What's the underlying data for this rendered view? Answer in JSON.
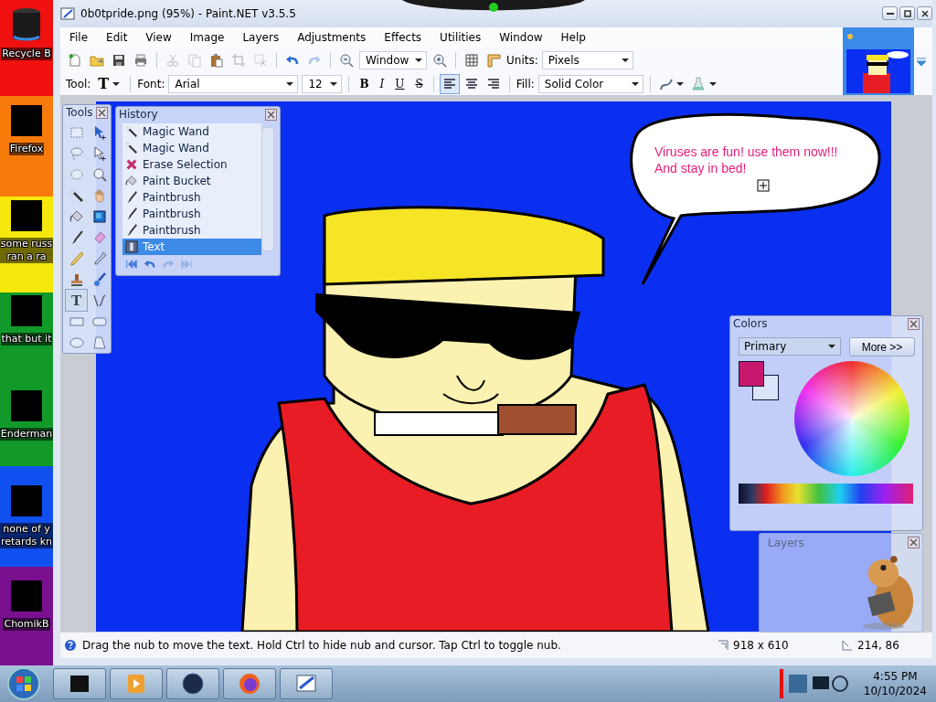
{
  "desktop_icons": [
    {
      "kind": "bin",
      "lines": [
        "Recycle B"
      ]
    },
    {
      "kind": "block",
      "lines": [
        "Firefox"
      ]
    },
    {
      "kind": "block",
      "lines": [
        "some russ",
        "ran a ra"
      ]
    },
    {
      "kind": "block",
      "lines": [
        "that but it"
      ]
    },
    {
      "kind": "block",
      "lines": [
        "Enderman"
      ]
    },
    {
      "kind": "block",
      "lines": [
        "none of y",
        "retards kn"
      ]
    },
    {
      "kind": "block",
      "lines": [
        "ChomikB"
      ]
    }
  ],
  "window": {
    "title": "0b0tpride.png (95%) - Paint.NET v3.5.5",
    "controls": [
      {
        "kind": "minimize"
      },
      {
        "kind": "maximize"
      },
      {
        "kind": "close"
      }
    ]
  },
  "menu": [
    "File",
    "Edit",
    "View",
    "Image",
    "Layers",
    "Adjustments",
    "Effects",
    "Utilities",
    "Window",
    "Help"
  ],
  "toolbar": [
    {
      "kind": "new",
      "disabled": false
    },
    {
      "kind": "open",
      "disabled": false
    },
    {
      "kind": "save",
      "disabled": false
    },
    {
      "kind": "print",
      "disabled": false
    },
    {
      "kind": "separator"
    },
    {
      "kind": "cut",
      "disabled": true
    },
    {
      "kind": "copy",
      "disabled": true
    },
    {
      "kind": "paste",
      "disabled": false
    },
    {
      "kind": "crop",
      "disabled": true
    },
    {
      "kind": "deselect",
      "disabled": true
    },
    {
      "kind": "separator"
    },
    {
      "kind": "undo",
      "disabled": false
    },
    {
      "kind": "redo",
      "disabled": true
    },
    {
      "kind": "separator"
    },
    {
      "kind": "zoom-out",
      "disabled": false
    },
    {
      "kind": "zoom-dropdown",
      "value": "Window"
    },
    {
      "kind": "zoom-in",
      "disabled": false
    },
    {
      "kind": "separator"
    },
    {
      "kind": "grid",
      "disabled": false
    },
    {
      "kind": "rulers",
      "disabled": false
    },
    {
      "kind": "label",
      "text": "Units:"
    },
    {
      "kind": "units-dropdown",
      "value": "Pixels"
    }
  ],
  "text_toolbar": [
    {
      "kind": "label",
      "text": "Tool:"
    },
    {
      "kind": "tool-picker",
      "text": "T"
    },
    {
      "kind": "separator"
    },
    {
      "kind": "label",
      "text": "Font:"
    },
    {
      "kind": "font-dropdown",
      "value": "Arial"
    },
    {
      "kind": "size-dropdown",
      "value": "12"
    },
    {
      "kind": "separator"
    },
    {
      "kind": "style",
      "text": "B",
      "selected": false
    },
    {
      "kind": "style",
      "text": "I",
      "selected": false
    },
    {
      "kind": "style",
      "text": "U",
      "selected": false
    },
    {
      "kind": "style",
      "text": "S",
      "selected": false
    },
    {
      "kind": "separator"
    },
    {
      "kind": "align-left",
      "selected": true
    },
    {
      "kind": "align-center",
      "selected": false
    },
    {
      "kind": "align-right",
      "selected": false
    },
    {
      "kind": "separator"
    },
    {
      "kind": "label",
      "text": "Fill:"
    },
    {
      "kind": "fill-dropdown",
      "value": "Solid Color"
    },
    {
      "kind": "separator"
    },
    {
      "kind": "antialias"
    },
    {
      "kind": "blend"
    }
  ],
  "canvas": {
    "bubble_text": [
      "Viruses are fun! use them now!!!",
      "And stay in bed!"
    ]
  },
  "tools_panel": {
    "title": "Tools",
    "tools": [
      {
        "kind": "rect-select",
        "selected": false
      },
      {
        "kind": "move-selected",
        "selected": false
      },
      {
        "kind": "lasso",
        "selected": false
      },
      {
        "kind": "move-selection",
        "selected": false
      },
      {
        "kind": "ellipse-select",
        "selected": false
      },
      {
        "kind": "zoom",
        "selected": false
      },
      {
        "kind": "magic-wand",
        "selected": false
      },
      {
        "kind": "pan",
        "selected": false
      },
      {
        "kind": "bucket",
        "selected": false
      },
      {
        "kind": "gradient",
        "selected": false
      },
      {
        "kind": "brush",
        "selected": false
      },
      {
        "kind": "eraser",
        "selected": false
      },
      {
        "kind": "pencil",
        "selected": false
      },
      {
        "kind": "picker",
        "selected": false
      },
      {
        "kind": "stamp",
        "selected": false
      },
      {
        "kind": "recolor",
        "selected": false
      },
      {
        "kind": "text",
        "glyph": "T",
        "selected": true
      },
      {
        "kind": "line",
        "selected": false
      },
      {
        "kind": "rectangle",
        "selected": false
      },
      {
        "kind": "rounded-rectangle",
        "selected": false
      },
      {
        "kind": "ellipse",
        "selected": false
      },
      {
        "kind": "freeform",
        "selected": false
      }
    ]
  },
  "history_panel": {
    "title": "History",
    "items": [
      {
        "kind": "wand",
        "label": "Magic Wand",
        "selected": false
      },
      {
        "kind": "wand",
        "label": "Magic Wand",
        "selected": false
      },
      {
        "kind": "erase",
        "label": "Erase Selection",
        "selected": false
      },
      {
        "kind": "bucket",
        "label": "Paint Bucket",
        "selected": false
      },
      {
        "kind": "brush",
        "label": "Paintbrush",
        "selected": false
      },
      {
        "kind": "brush",
        "label": "Paintbrush",
        "selected": false
      },
      {
        "kind": "brush",
        "label": "Paintbrush",
        "selected": false
      },
      {
        "kind": "text",
        "label": "Text",
        "selected": true
      }
    ],
    "controls": [
      {
        "kind": "first",
        "disabled": false
      },
      {
        "kind": "undo",
        "disabled": false
      },
      {
        "kind": "redo",
        "disabled": true
      },
      {
        "kind": "last",
        "disabled": true
      }
    ]
  },
  "colors_panel": {
    "title": "Colors",
    "mode": "Primary",
    "more": "More >>",
    "swatches": [
      {
        "kind": "primary",
        "color": "#c8186e"
      },
      {
        "kind": "secondary",
        "color": "#dce4fa"
      }
    ]
  },
  "layers_panel": {
    "title": "Layers"
  },
  "status_bar": {
    "hint": "Drag the nub to move the text. Hold Ctrl to hide nub and cursor. Tap Ctrl to toggle nub.",
    "size": "918 x 610",
    "cursor": "214, 86"
  },
  "taskbar": {
    "apps": [
      {
        "kind": "block"
      },
      {
        "kind": "media"
      },
      {
        "kind": "globe"
      },
      {
        "kind": "firefox"
      },
      {
        "kind": "paint"
      }
    ],
    "time": "4:55 PM",
    "date": "10/10/2024"
  }
}
